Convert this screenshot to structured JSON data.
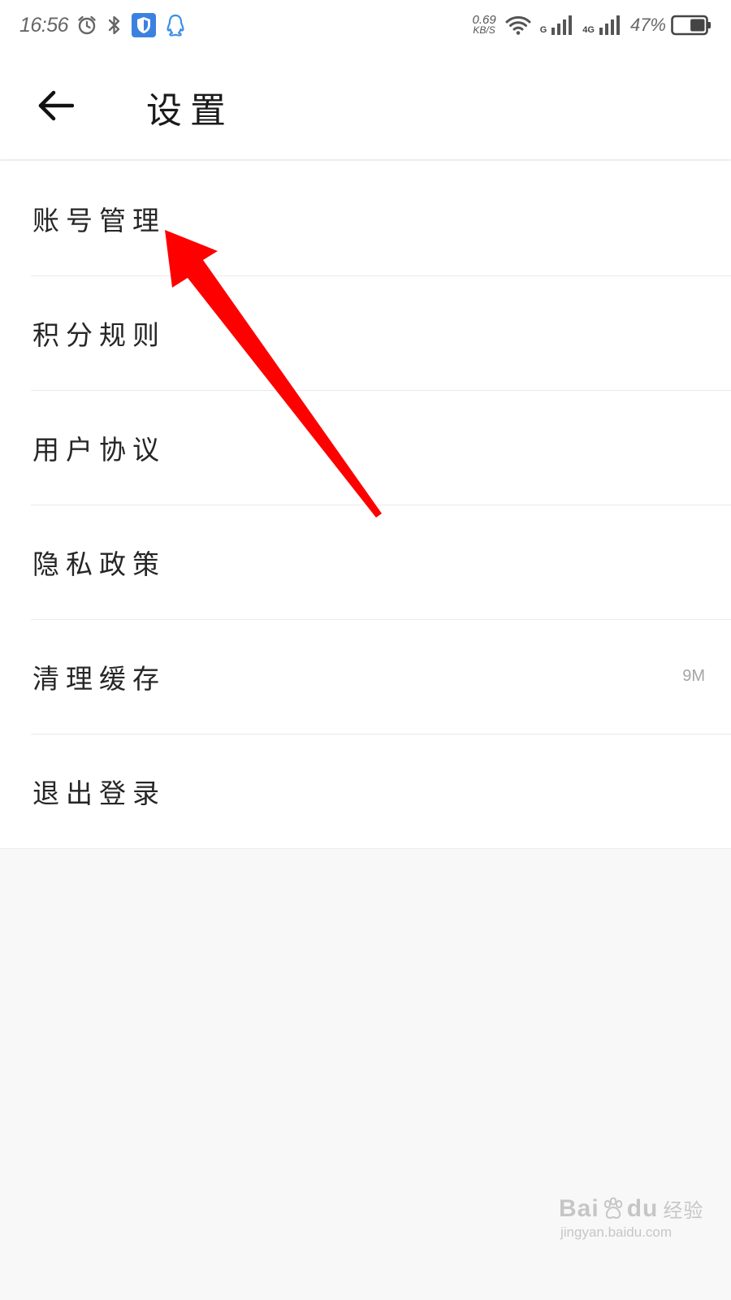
{
  "status_bar": {
    "time": "16:56",
    "net_speed_value": "0.69",
    "net_speed_unit": "KB/S",
    "sim1_label": "G",
    "sim2_label": "4G",
    "battery_percent": "47%",
    "battery_level": 0.47,
    "icons": [
      "alarm-icon",
      "bluetooth-icon",
      "shield-icon",
      "qq-icon",
      "wifi-icon",
      "signal-icon",
      "battery-icon"
    ],
    "shield_color": "#3b82e0",
    "qq_color": "#3b8fe8"
  },
  "header": {
    "back_icon": "back-arrow-icon",
    "title": "设置"
  },
  "settings": {
    "items": [
      {
        "label": "账号管理",
        "value": ""
      },
      {
        "label": "积分规则",
        "value": ""
      },
      {
        "label": "用户协议",
        "value": ""
      },
      {
        "label": "隐私政策",
        "value": ""
      },
      {
        "label": "清理缓存",
        "value": "9M"
      },
      {
        "label": "退出登录",
        "value": ""
      }
    ]
  },
  "annotation": {
    "color": "#ff0000"
  },
  "watermark": {
    "brand": "Bai",
    "brand_tail": "du",
    "brand_cn": "经验",
    "url": "jingyan.baidu.com"
  }
}
